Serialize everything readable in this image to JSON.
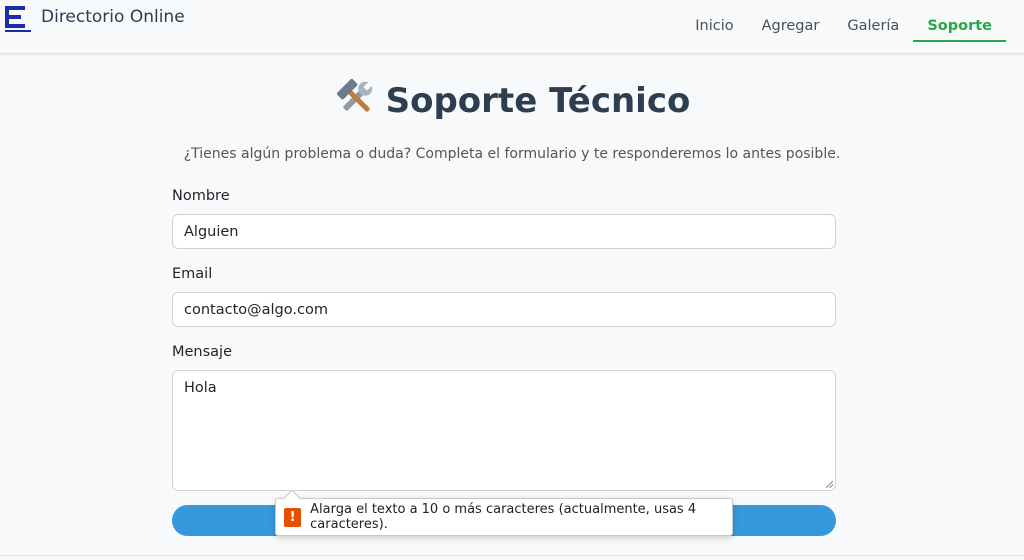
{
  "brand": {
    "title": "Directorio Online",
    "logo_name": "directorio-logo"
  },
  "nav": {
    "items": [
      {
        "label": "Inicio",
        "active": false
      },
      {
        "label": "Agregar",
        "active": false
      },
      {
        "label": "Galería",
        "active": false
      },
      {
        "label": "Soporte",
        "active": true
      }
    ],
    "active_color": "#28a745"
  },
  "page": {
    "title": "Soporte Técnico",
    "title_icon": "tools-icon",
    "subtitle": "¿Tienes algún problema o duda? Completa el formulario y te responderemos lo antes posible."
  },
  "form": {
    "name_label": "Nombre",
    "name_value": "Alguien",
    "email_label": "Email",
    "email_value": "contacto@algo.com",
    "message_label": "Mensaje",
    "message_value": "Hola",
    "submit_color": "#3498db"
  },
  "validation": {
    "icon": "warning-icon",
    "message": "Alarga el texto a 10 o más caracteres (actualmente, usas 4 caracteres)."
  }
}
